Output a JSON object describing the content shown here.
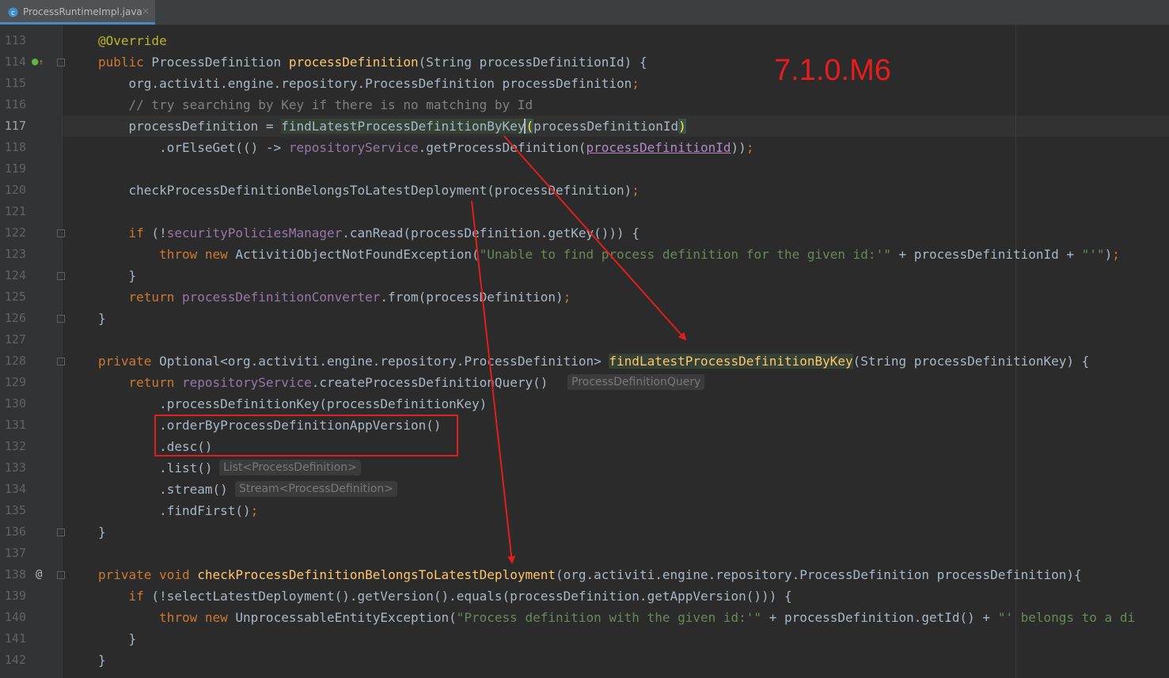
{
  "tab": {
    "file_name": "ProcessRuntimeImpl.java",
    "icon": "java-class-icon",
    "close_glyph": "×"
  },
  "gutter": {
    "line_numbers": [
      "113",
      "114",
      "115",
      "116",
      "117",
      "118",
      "119",
      "120",
      "121",
      "122",
      "123",
      "124",
      "125",
      "126",
      "127",
      "128",
      "129",
      "130",
      "131",
      "132",
      "133",
      "134",
      "135",
      "136",
      "137",
      "138",
      "139",
      "140",
      "141",
      "142"
    ],
    "current_line": "117",
    "icon_114": "implements-icon",
    "icon_138": "@"
  },
  "code": {
    "l113": {
      "ann": "@Override"
    },
    "l114": {
      "kw": "public",
      "t1": " ProcessDefinition ",
      "fn": "processDefinition",
      "t2": "(String processDefinitionId) {"
    },
    "l115": {
      "t1": "    org.activiti.engine.repository.ProcessDefinition processDefinition",
      "semi": ";"
    },
    "l116": {
      "cmt": "    // try searching by Key if there is no matching by Id"
    },
    "l117": {
      "t1": "    processDefinition = ",
      "call": "findLatestProcessDefinitionByKey",
      "paren_open": "(",
      "t2": "processDefinitionId",
      "paren_close": ")"
    },
    "l118": {
      "t1": "        .orElseGet(() -> ",
      "fld": "repositoryService",
      "t2": ".getProcessDefinition(",
      "param": "processDefinitionId",
      "t3": "))",
      "semi": ";"
    },
    "l119": {},
    "l120": {
      "t1": "    checkProcessDefinitionBelongsToLatestDeployment(processDefinition)",
      "semi": ";"
    },
    "l121": {},
    "l122": {
      "kw": "    if",
      "t1": " (!",
      "fld": "securityPoliciesManager",
      "t2": ".canRead(processDefinition.getKey())) {"
    },
    "l123": {
      "kw1": "        throw",
      "kw2": " new",
      "t1": " ActivitiObjectNotFoundException(",
      "str": "\"Unable to find process definition for the given id:'\"",
      "t2": " + processDefinitionId + ",
      "str2": "\"'\"",
      "t3": ")",
      "semi": ";"
    },
    "l124": {
      "t1": "    }"
    },
    "l125": {
      "kw": "    return",
      "t1": " ",
      "fld": "processDefinitionConverter",
      "t2": ".from(processDefinition)",
      "semi": ";"
    },
    "l126": {
      "t1": "}"
    },
    "l127": {},
    "l128": {
      "kw": "private",
      "t1": " Optional<org.activiti.engine.repository.ProcessDefinition> ",
      "decl": "findLatestProcessDefinitionByKey",
      "t2": "(String processDefinitionKey) {"
    },
    "l129": {
      "kw": "    return",
      "t1": " ",
      "fld": "repositoryService",
      "t2": ".createProcessDefinitionQuery()"
    },
    "l130": {
      "t1": "        .processDefinitionKey(processDefinitionKey)"
    },
    "l131": {
      "t1": "        .orderByProcessDefinitionAppVersion()"
    },
    "l132": {
      "t1": "        .desc()"
    },
    "l133": {
      "t1": "        .list()"
    },
    "l134": {
      "t1": "        .stream()"
    },
    "l135": {
      "t1": "        .findFirst()",
      "semi": ";"
    },
    "l136": {
      "t1": "}"
    },
    "l137": {},
    "l138": {
      "kw1": "private",
      "kw2": " void",
      "t1": " ",
      "decl": "checkProcessDefinitionBelongsToLatestDeployment",
      "t2": "(org.activiti.engine.repository.ProcessDefinition processDefinition){"
    },
    "l139": {
      "kw": "    if",
      "t1": " (!selectLatestDeployment().getVersion().equals(processDefinition.getAppVersion())) {"
    },
    "l140": {
      "kw1": "        throw",
      "kw2": " new",
      "t1": " UnprocessableEntityException(",
      "str": "\"Process definition with the given id:'\"",
      "t2": " + processDefinition.getId() + ",
      "str2": "\"' belongs to a di"
    },
    "l141": {
      "t1": "    }"
    },
    "l142": {
      "t1": "}"
    }
  },
  "inlay_hints": {
    "h129": "ProcessDefinitionQuery",
    "h133": "List<ProcessDefinition>",
    "h134": "Stream<ProcessDefinition>"
  },
  "annotation": {
    "version_label": "7.1.0.M6",
    "color": "#e81c1c"
  },
  "theme": {
    "background": "#2b2b2b",
    "keyword": "#cc7832",
    "function": "#ffc66d",
    "string": "#6a8759",
    "field": "#9876aa"
  }
}
